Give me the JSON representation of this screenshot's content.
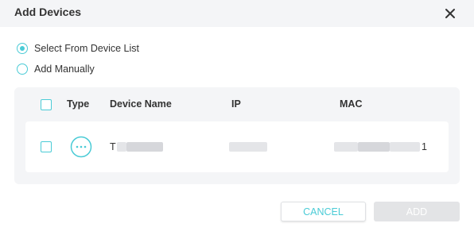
{
  "dialog": {
    "title": "Add Devices",
    "close_icon": "close-icon"
  },
  "options": [
    {
      "label": "Select From Device List",
      "selected": true
    },
    {
      "label": "Add Manually",
      "selected": false
    }
  ],
  "table": {
    "headers": {
      "type": "Type",
      "device_name": "Device Name",
      "ip": "IP",
      "mac": "MAC"
    },
    "rows": [
      {
        "checked": false,
        "type_icon": "more-icon",
        "device_name_visible": "T",
        "ip_visible": "",
        "mac_visible": "1"
      }
    ]
  },
  "buttons": {
    "cancel": "CANCEL",
    "add": "ADD"
  },
  "colors": {
    "accent": "#4acbd6",
    "panel_bg": "#f4f5f7",
    "disabled_btn": "#e3e4e6"
  }
}
